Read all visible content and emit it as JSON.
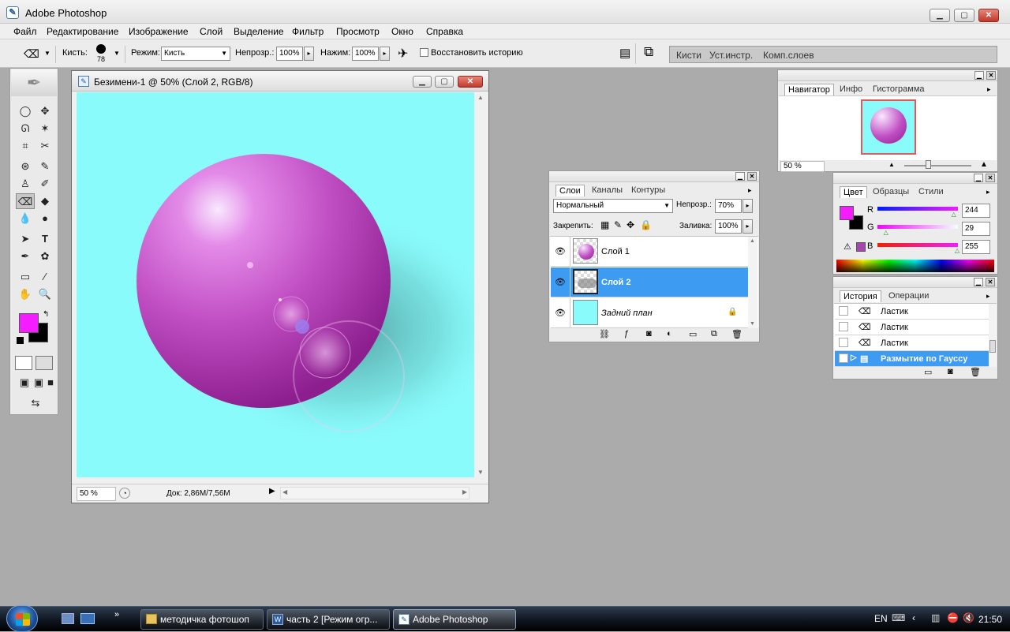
{
  "app": {
    "title": "Adobe Photoshop"
  },
  "menu": [
    "Файл",
    "Редактирование",
    "Изображение",
    "Слой",
    "Выделение",
    "Фильтр",
    "Просмотр",
    "Окно",
    "Справка"
  ],
  "options": {
    "brush_label": "Кисть:",
    "brush_size": "78",
    "mode_label": "Режим:",
    "mode_value": "Кисть",
    "opacity_label": "Непрозр.:",
    "opacity_value": "100%",
    "pressure_label": "Нажим:",
    "pressure_value": "100%",
    "restore_history": "Восстановить историю"
  },
  "palette_well": [
    "Кисти",
    "Уст.инстр.",
    "Комп.слоев"
  ],
  "document": {
    "title": "Безимени-1 @ 50% (Слой 2, RGB/8)",
    "zoom": "50 %",
    "doc_info": "Док: 2,86M/7,56M"
  },
  "navigator": {
    "tabs": [
      "Навигатор",
      "Инфо",
      "Гистограмма"
    ],
    "zoom": "50 %"
  },
  "layers": {
    "tabs": [
      "Слои",
      "Каналы",
      "Контуры"
    ],
    "blend_mode": "Нормальный",
    "opacity_label": "Непрозр.:",
    "opacity_value": "70%",
    "lock_label": "Закрепить:",
    "fill_label": "Заливка:",
    "fill_value": "100%",
    "items": [
      {
        "name": "Слой 1",
        "selected": false
      },
      {
        "name": "Слой 2",
        "selected": true
      },
      {
        "name": "Задний план",
        "selected": false
      }
    ]
  },
  "color": {
    "tabs": [
      "Цвет",
      "Образцы",
      "Стили"
    ],
    "r_label": "R",
    "g_label": "G",
    "b_label": "B",
    "r": "244",
    "g": "29",
    "b": "255",
    "foreground": "#f41dff",
    "background": "#000000",
    "sliders": {
      "r": 0.957,
      "g": 0.114,
      "b": 1.0
    }
  },
  "history": {
    "tabs": [
      "История",
      "Операции"
    ],
    "items": [
      {
        "label": "Ластик",
        "selected": false
      },
      {
        "label": "Ластик",
        "selected": false
      },
      {
        "label": "Ластик",
        "selected": false
      },
      {
        "label": "Размытие по Гауссу",
        "selected": true
      }
    ]
  },
  "taskbar": {
    "buttons": [
      "методичка фотошоп",
      "часть 2 [Режим огр...",
      "Adobe Photoshop"
    ],
    "lang": "EN",
    "time": "21:50"
  }
}
